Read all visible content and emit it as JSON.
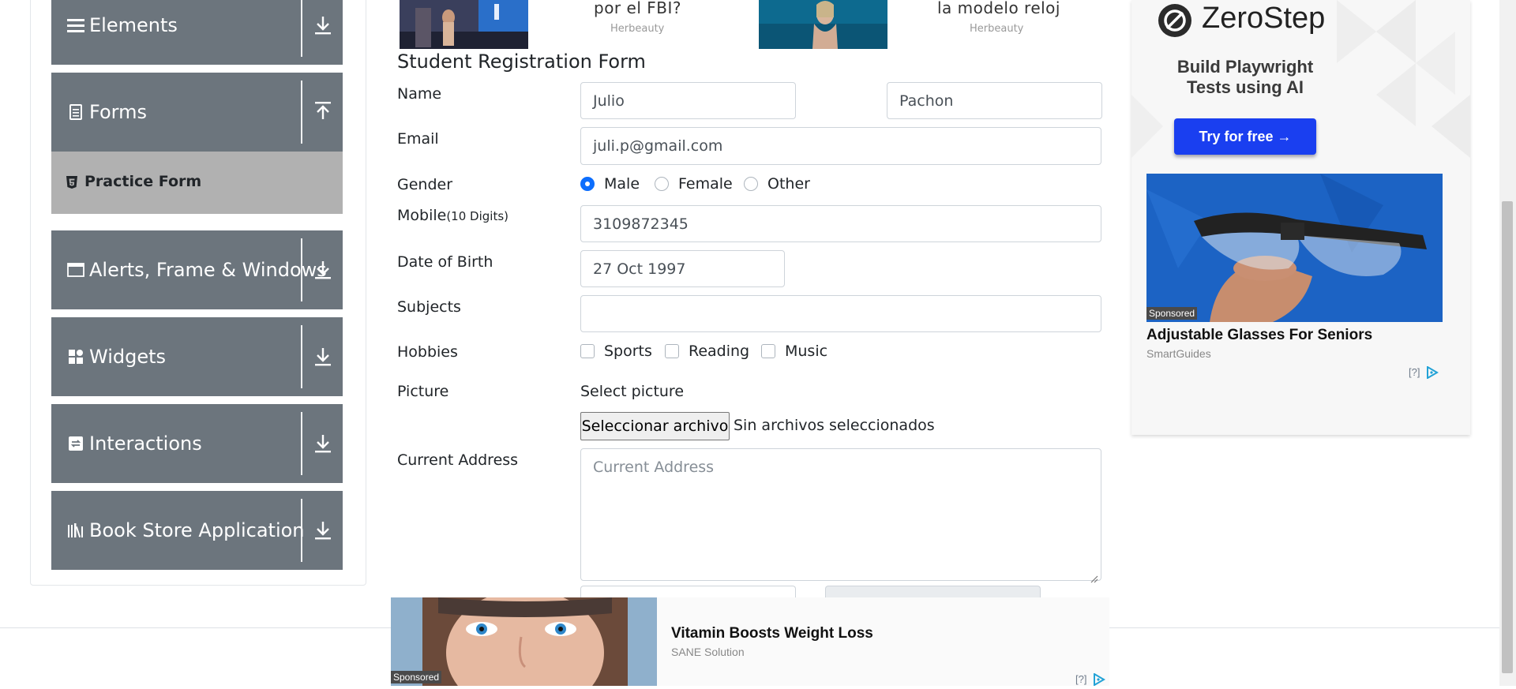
{
  "sidebar": {
    "groups": [
      {
        "label": "Elements",
        "icon": "menu-icon",
        "arrow": "download-arrow-icon"
      },
      {
        "label": "Forms",
        "icon": "document-icon",
        "arrow": "upload-arrow-icon"
      },
      {
        "label": "Alerts, Frame & Windows",
        "icon": "window-icon",
        "arrow": "download-arrow-icon"
      },
      {
        "label": "Widgets",
        "icon": "widgets-icon",
        "arrow": "download-arrow-icon"
      },
      {
        "label": "Interactions",
        "icon": "interactions-icon",
        "arrow": "download-arrow-icon"
      },
      {
        "label": "Book Store Application",
        "icon": "books-icon",
        "arrow": "download-arrow-icon"
      }
    ],
    "active_item": {
      "label": "Practice Form",
      "icon": "html5-icon"
    }
  },
  "top_ads": [
    {
      "headline": "por el FBI?",
      "source": "Herbeauty"
    },
    {
      "headline": "la modelo reloj",
      "source": "Herbeauty"
    }
  ],
  "form": {
    "title": "Student Registration Form",
    "name_label": "Name",
    "first_name": "Julio",
    "last_name": "Pachon",
    "email_label": "Email",
    "email": "juli.p@gmail.com",
    "gender_label": "Gender",
    "gender_options": [
      "Male",
      "Female",
      "Other"
    ],
    "gender_selected": "Male",
    "mobile_label": "Mobile",
    "mobile_hint": "(10 Digits)",
    "mobile": "3109872345",
    "dob_label": "Date of Birth",
    "dob": "27 Oct 1997",
    "subjects_label": "Subjects",
    "subjects": "",
    "hobbies_label": "Hobbies",
    "hobbies": [
      "Sports",
      "Reading",
      "Music"
    ],
    "picture_label": "Picture",
    "select_picture": "Select picture",
    "file_button": "Seleccionar archivo",
    "file_status": "Sin archivos seleccionados",
    "address_label": "Current Address",
    "address_placeholder": "Current Address"
  },
  "right_ad": {
    "brand": "ZeroStep",
    "tagline_line1": "Build Playwright",
    "tagline_line2": "Tests using AI",
    "cta": "Try for free →",
    "sponsored": "Sponsored",
    "title": "Adjustable Glasses For Seniors",
    "source": "SmartGuides",
    "adchoice": "[?]"
  },
  "bottom_ad": {
    "sponsored": "Sponsored",
    "title": "Vitamin Boosts Weight Loss",
    "source": "SANE Solution",
    "adchoice": "[?]"
  },
  "colors": {
    "sidebar_group": "#6c757d",
    "sidebar_active": "#b1b1b1",
    "radio_checked": "#0d6efd",
    "cta_blue": "#1a3ff0"
  }
}
